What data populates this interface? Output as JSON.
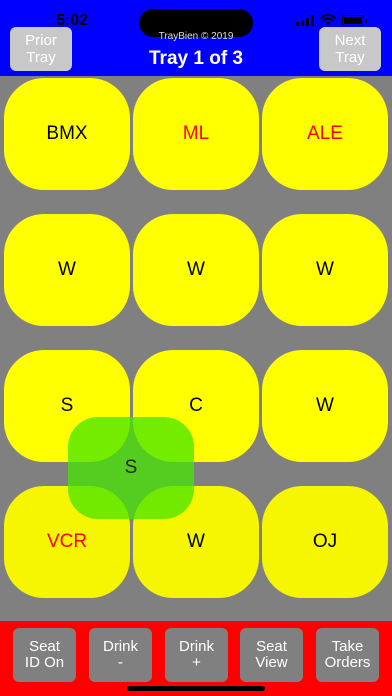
{
  "status_bar": {
    "time": "5:02"
  },
  "header": {
    "copyright": "TrayBien © 2019",
    "title": "Tray 1 of 3",
    "prior_label": "Prior\nTray",
    "next_label": "Next\nTray",
    "background_color": "#0000ff"
  },
  "tiles": [
    {
      "label": "BMX",
      "color": "#000000"
    },
    {
      "label": "ML",
      "color": "#ff0000"
    },
    {
      "label": "ALE",
      "color": "#ff0000"
    },
    {
      "label": "W",
      "color": "#000000"
    },
    {
      "label": "W",
      "color": "#000000"
    },
    {
      "label": "W",
      "color": "#000000"
    },
    {
      "label": "S",
      "color": "#000000"
    },
    {
      "label": "C",
      "color": "#000000"
    },
    {
      "label": "W",
      "color": "#000000"
    },
    {
      "label": "VCR",
      "color": "#ff0000"
    },
    {
      "label": "W",
      "color": "#000000"
    },
    {
      "label": "OJ",
      "color": "#000000"
    }
  ],
  "dragged_seat": {
    "label": "S"
  },
  "toolbar": {
    "background_color": "#ff0000",
    "buttons": [
      {
        "label": "Seat\nID On"
      },
      {
        "label": "Drink\n-"
      },
      {
        "label": "Drink\n+"
      },
      {
        "label": "Seat\nView"
      },
      {
        "label": "Take\nOrders"
      }
    ]
  }
}
